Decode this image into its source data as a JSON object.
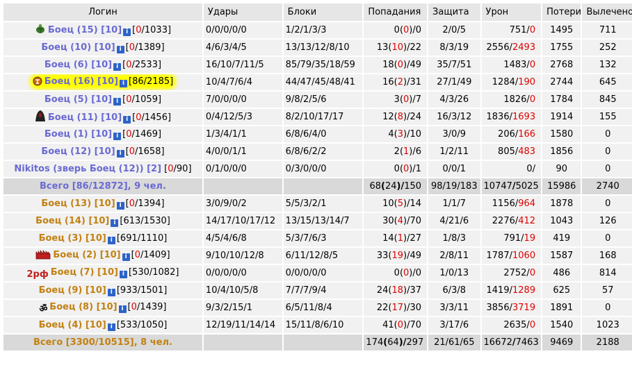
{
  "headers": [
    "Логин",
    "Удары",
    "Блоки",
    "Попадания",
    "Защита",
    "Урон",
    "Потери",
    "Вылечено"
  ],
  "team1": [
    {
      "name": "Боец (15) [10]",
      "hp": "0",
      "hp_max": "1033",
      "hits": "0/0/0/0/0",
      "blocks": "1/2/1/3/3",
      "acc_a": "0",
      "acc_b": "0",
      "acc_c": "0",
      "def": "2/0/5",
      "dmg_a": "751",
      "dmg_b": "0",
      "loss": "1495",
      "heal": "711",
      "icon": "turtle-icon"
    },
    {
      "name": "Боец (10) [10]",
      "hp": "0",
      "hp_max": "1389",
      "hits": "4/6/3/4/5",
      "blocks": "13/13/12/8/10",
      "acc_a": "13",
      "acc_b": "10",
      "acc_c": "22",
      "def": "8/3/19",
      "dmg_a": "2556",
      "dmg_b": "2493",
      "loss": "1755",
      "heal": "252"
    },
    {
      "name": "Боец (6) [10]",
      "hp": "0",
      "hp_max": "2533",
      "hits": "16/10/7/11/5",
      "blocks": "85/79/35/18/59",
      "acc_a": "18",
      "acc_b": "0",
      "acc_c": "49",
      "def": "35/7/51",
      "dmg_a": "1483",
      "dmg_b": "0",
      "loss": "2768",
      "heal": "132"
    },
    {
      "name": "Боец (16) [10]",
      "hp": "86",
      "hp_max": "2185",
      "hits": "10/4/7/6/4",
      "blocks": "44/47/45/48/41",
      "acc_a": "16",
      "acc_b": "2",
      "acc_c": "31",
      "def": "27/1/49",
      "dmg_a": "1284",
      "dmg_b": "190",
      "loss": "2744",
      "heal": "645",
      "icon": "sign-icon",
      "highlight": true
    },
    {
      "name": "Боец (5) [10]",
      "hp": "0",
      "hp_max": "1059",
      "hits": "7/0/0/0/0",
      "blocks": "9/8/2/5/6",
      "acc_a": "3",
      "acc_b": "0",
      "acc_c": "7",
      "def": "4/3/26",
      "dmg_a": "1826",
      "dmg_b": "0",
      "loss": "1784",
      "heal": "845"
    },
    {
      "name": "Боец (11) [10]",
      "hp": "0",
      "hp_max": "1456",
      "hits": "0/4/12/5/3",
      "blocks": "8/2/10/17/17",
      "acc_a": "12",
      "acc_b": "8",
      "acc_c": "24",
      "def": "16/3/12",
      "dmg_a": "1836",
      "dmg_b": "1693",
      "loss": "1914",
      "heal": "155",
      "icon": "hood-icon"
    },
    {
      "name": "Боец (1) [10]",
      "hp": "0",
      "hp_max": "1469",
      "hits": "1/3/4/1/1",
      "blocks": "6/8/6/4/0",
      "acc_a": "4",
      "acc_b": "3",
      "acc_c": "10",
      "def": "3/0/9",
      "dmg_a": "206",
      "dmg_b": "166",
      "loss": "1580",
      "heal": "0"
    },
    {
      "name": "Боец (12) [10]",
      "hp": "0",
      "hp_max": "1658",
      "hits": "4/0/0/1/1",
      "blocks": "6/8/6/2/2",
      "acc_a": "2",
      "acc_b": "1",
      "acc_c": "6",
      "def": "1/2/11",
      "dmg_a": "805",
      "dmg_b": "483",
      "loss": "1856",
      "heal": "0"
    },
    {
      "name": "Nikitos (зверь Боец (12)) [2]",
      "hp": "0",
      "hp_max": "90",
      "hits": "0/1/0/0/0",
      "blocks": "0/3/0/0/0",
      "acc_a": "0",
      "acc_b": "0",
      "acc_c": "1",
      "def": "0/0/1",
      "dmg_a": "0",
      "dmg_b": "",
      "loss": "90",
      "heal": "0",
      "noinfo": true
    }
  ],
  "total1": {
    "label": "Всего [86/12872], 9 чел.",
    "acc_a": "68",
    "acc_b": "24",
    "acc_c": "150",
    "def": "98/19/183",
    "dmg_a": "10747",
    "dmg_b": "5025",
    "loss": "15986",
    "heal": "2740"
  },
  "team2": [
    {
      "name": "Боец (13) [10]",
      "hp": "0",
      "hp_max": "1394",
      "hits": "3/0/9/0/2",
      "blocks": "5/5/3/2/1",
      "acc_a": "10",
      "acc_b": "5",
      "acc_c": "14",
      "def": "1/1/7",
      "dmg_a": "1156",
      "dmg_b": "964",
      "loss": "1878",
      "heal": "0"
    },
    {
      "name": "Боец (14) [10]",
      "hp": "613",
      "hp_max": "1530",
      "hits": "14/17/10/17/12",
      "blocks": "13/15/13/14/7",
      "acc_a": "30",
      "acc_b": "4",
      "acc_c": "70",
      "def": "4/21/6",
      "dmg_a": "2276",
      "dmg_b": "412",
      "loss": "1043",
      "heal": "126"
    },
    {
      "name": "Боец (3) [10]",
      "hp": "691",
      "hp_max": "1110",
      "hits": "4/5/4/6/8",
      "blocks": "5/3/7/6/3",
      "acc_a": "14",
      "acc_b": "1",
      "acc_c": "27",
      "def": "1/8/3",
      "dmg_a": "791",
      "dmg_b": "19",
      "loss": "419",
      "heal": "0"
    },
    {
      "name": "Боец (2) [10]",
      "hp": "0",
      "hp_max": "1409",
      "hits": "9/10/10/12/8",
      "blocks": "6/11/12/8/5",
      "acc_a": "33",
      "acc_b": "19",
      "acc_c": "49",
      "def": "2/8/11",
      "dmg_a": "1787",
      "dmg_b": "1060",
      "loss": "1587",
      "heal": "168",
      "icon": "crown-icon"
    },
    {
      "name": "Боец (7) [10]",
      "hp": "530",
      "hp_max": "1082",
      "hits": "0/0/0/0/0",
      "blocks": "0/0/0/0/0",
      "acc_a": "0",
      "acc_b": "0",
      "acc_c": "0",
      "def": "1/0/13",
      "dmg_a": "2752",
      "dmg_b": "0",
      "loss": "486",
      "heal": "814",
      "icon": "twotext-icon",
      "icon_text": "2рф"
    },
    {
      "name": "Боец (9) [10]",
      "hp": "933",
      "hp_max": "1501",
      "hits": "10/4/10/5/8",
      "blocks": "7/7/7/9/4",
      "acc_a": "24",
      "acc_b": "18",
      "acc_c": "37",
      "def": "6/3/8",
      "dmg_a": "1419",
      "dmg_b": "1289",
      "loss": "625",
      "heal": "57"
    },
    {
      "name": "Боец (8) [10]",
      "hp": "0",
      "hp_max": "1439",
      "hits": "9/3/2/15/1",
      "blocks": "6/5/11/8/4",
      "acc_a": "22",
      "acc_b": "17",
      "acc_c": "30",
      "def": "3/3/11",
      "dmg_a": "3856",
      "dmg_b": "3719",
      "loss": "1891",
      "heal": "0",
      "icon": "om-icon",
      "icon_text": "ॐ"
    },
    {
      "name": "Боец (4) [10]",
      "hp": "533",
      "hp_max": "1050",
      "hits": "12/19/11/14/14",
      "blocks": "15/11/8/6/10",
      "acc_a": "41",
      "acc_b": "0",
      "acc_c": "70",
      "def": "3/17/6",
      "dmg_a": "2635",
      "dmg_b": "0",
      "loss": "1540",
      "heal": "1023"
    }
  ],
  "total2": {
    "label": "Всего [3300/10515], 8 чел.",
    "acc_a": "174",
    "acc_b": "64",
    "acc_c": "297",
    "def": "21/61/65",
    "dmg_a": "16672",
    "dmg_b": "7463",
    "loss": "9469",
    "heal": "2188"
  },
  "colors": {
    "team1": "#6a6ad4",
    "team2": "#c28112",
    "red": "#e00000",
    "highlight": "#ffff00"
  }
}
